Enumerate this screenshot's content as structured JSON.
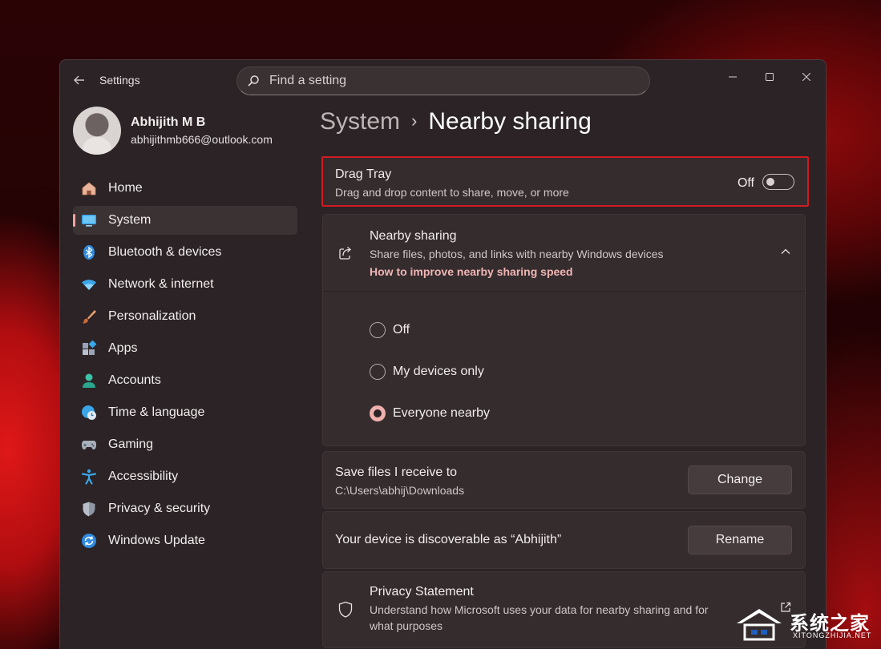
{
  "window": {
    "app_title": "Settings",
    "search_placeholder": "Find a setting"
  },
  "profile": {
    "name": "Abhijith M B",
    "email": "abhijithmb666@outlook.com"
  },
  "sidebar": {
    "items": [
      {
        "label": "Home",
        "icon": "home-icon"
      },
      {
        "label": "System",
        "icon": "system-icon",
        "active": true
      },
      {
        "label": "Bluetooth & devices",
        "icon": "bluetooth-icon"
      },
      {
        "label": "Network & internet",
        "icon": "wifi-icon"
      },
      {
        "label": "Personalization",
        "icon": "brush-icon"
      },
      {
        "label": "Apps",
        "icon": "apps-icon"
      },
      {
        "label": "Accounts",
        "icon": "person-icon"
      },
      {
        "label": "Time & language",
        "icon": "globe-clock-icon"
      },
      {
        "label": "Gaming",
        "icon": "gamepad-icon"
      },
      {
        "label": "Accessibility",
        "icon": "accessibility-icon"
      },
      {
        "label": "Privacy & security",
        "icon": "shield-icon"
      },
      {
        "label": "Windows Update",
        "icon": "update-icon"
      }
    ]
  },
  "breadcrumb": {
    "parent": "System",
    "current": "Nearby sharing"
  },
  "drag_tray": {
    "title": "Drag Tray",
    "description": "Drag and drop content to share, move, or more",
    "state_label": "Off",
    "enabled": false
  },
  "nearby_sharing": {
    "title": "Nearby sharing",
    "description": "Share files, photos, and links with nearby Windows devices",
    "link": "How to improve nearby sharing speed",
    "options": [
      {
        "label": "Off",
        "selected": false
      },
      {
        "label": "My devices only",
        "selected": false
      },
      {
        "label": "Everyone nearby",
        "selected": true
      }
    ]
  },
  "save_files": {
    "title": "Save files I receive to",
    "path": "C:\\Users\\abhij\\Downloads",
    "button": "Change"
  },
  "discoverable": {
    "title": "Your device is discoverable as “Abhijith”",
    "button": "Rename"
  },
  "privacy": {
    "title": "Privacy Statement",
    "description_line1": "Understand how Microsoft uses your data for nearby sharing and for",
    "description_line2": "what purposes"
  },
  "watermark": {
    "text": "系统之家",
    "sub": "XITONGZHIJIA.NET"
  },
  "colors": {
    "accent": "#f0b0ad",
    "highlight_border": "#d01b23",
    "window_bg": "#2b2325",
    "card_bg": "#352c2e"
  }
}
